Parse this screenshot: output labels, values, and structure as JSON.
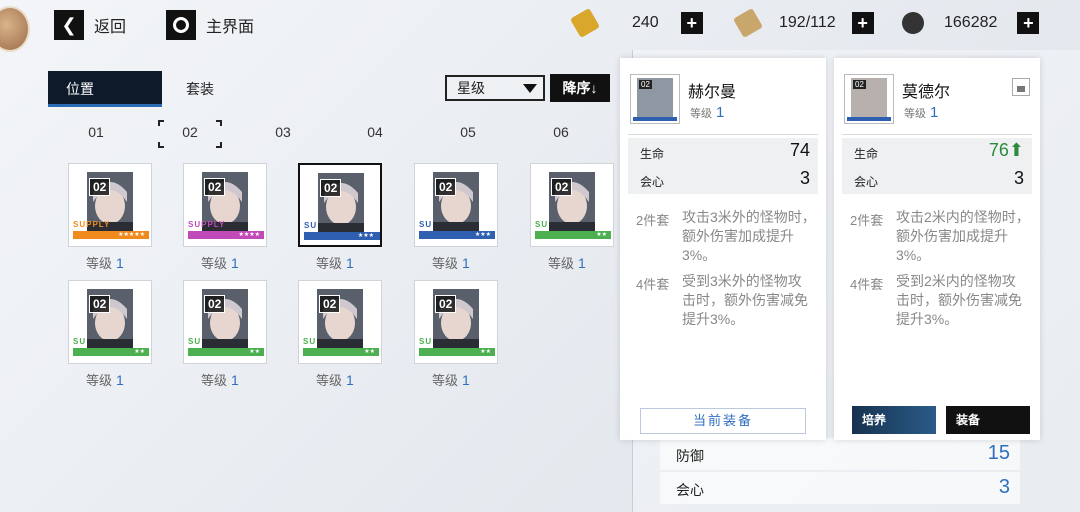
{
  "nav": {
    "back_label": "返回",
    "home_label": "主界面"
  },
  "resources": [
    {
      "icon": "gold-ticket-icon",
      "value": "240"
    },
    {
      "icon": "stamina-battery-icon",
      "value": "192/112"
    },
    {
      "icon": "black-crystal-icon",
      "value": "166282"
    }
  ],
  "tabs": {
    "position": "位置",
    "set": "套装"
  },
  "filter": {
    "selected": "星级",
    "sort_label": "降序↓"
  },
  "positions": [
    "01",
    "02",
    "03",
    "04",
    "05",
    "06"
  ],
  "inventory": {
    "level_label": "等级",
    "cards": [
      {
        "num": "02",
        "level": "1",
        "color": "#f08a1c",
        "brand": "SUPPLY",
        "stars": "★★★★★"
      },
      {
        "num": "02",
        "level": "1",
        "color": "#c04bb8",
        "brand": "SUPPLY",
        "stars": "★★★★"
      },
      {
        "num": "02",
        "level": "1",
        "color": "#2f5fb0",
        "brand": "SU",
        "stars": "★★★"
      },
      {
        "num": "02",
        "level": "1",
        "color": "#2f5fb0",
        "brand": "SU",
        "stars": "★★★"
      },
      {
        "num": "02",
        "level": "1",
        "color": "#4caf50",
        "brand": "SU",
        "stars": "★★"
      },
      {
        "num": "02",
        "level": "1",
        "color": "#4caf50",
        "brand": "SU",
        "stars": "★★"
      },
      {
        "num": "02",
        "level": "1",
        "color": "#4caf50",
        "brand": "SU",
        "stars": "★★"
      },
      {
        "num": "02",
        "level": "1",
        "color": "#4caf50",
        "brand": "SU",
        "stars": "★★"
      },
      {
        "num": "02",
        "level": "1",
        "color": "#4caf50",
        "brand": "SU",
        "stars": "★★"
      }
    ]
  },
  "background_panel": {
    "rows": [
      {
        "label": "防御",
        "value": "15"
      },
      {
        "label": "会心",
        "value": "3"
      }
    ]
  },
  "popup_current": {
    "name": "赫尔曼",
    "level_label": "等级",
    "level": "1",
    "stats": [
      {
        "label": "生命",
        "value": "74"
      },
      {
        "label": "会心",
        "value": "3"
      }
    ],
    "set2_label": "2件套",
    "set2_desc": "攻击3米外的怪物时，额外伤害加成提升3%。",
    "set4_label": "4件套",
    "set4_desc": "受到3米外的怪物攻击时，额外伤害减免提升3%。",
    "button": "当前装备"
  },
  "popup_compare": {
    "name": "莫德尔",
    "level_label": "等级",
    "level": "1",
    "stats": [
      {
        "label": "生命",
        "value": "76⬆"
      },
      {
        "label": "会心",
        "value": "3"
      }
    ],
    "set2_label": "2件套",
    "set2_desc": "攻击2米内的怪物时，额外伤害加成提升3%。",
    "set4_label": "4件套",
    "set4_desc": "受到2米内的怪物攻击时，额外伤害减免提升3%。",
    "btn_upgrade": "培养",
    "btn_equip": "装备"
  },
  "colors": {
    "accent": "#2f6fbf",
    "up": "#2e8b3e"
  }
}
